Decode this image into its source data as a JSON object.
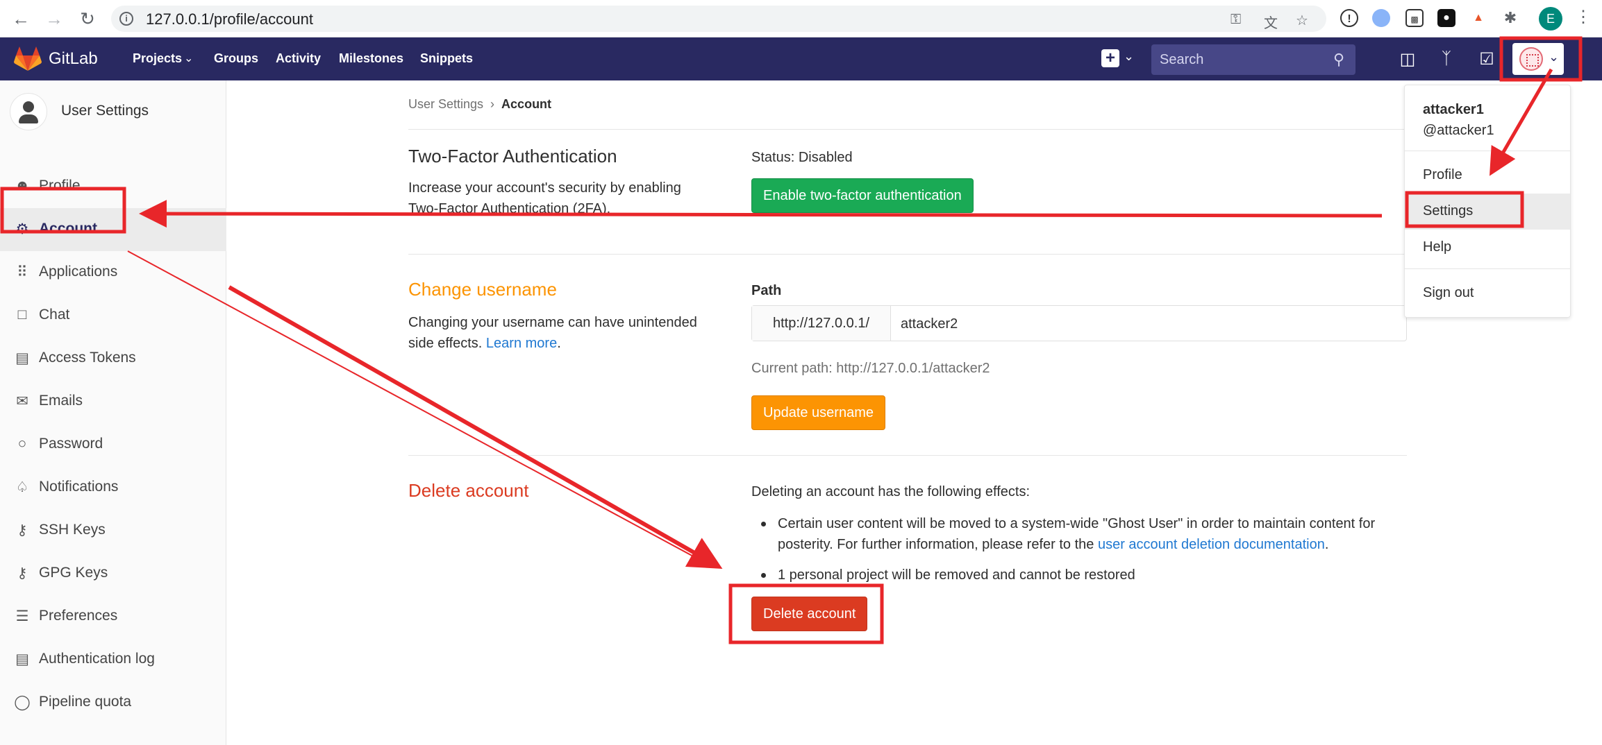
{
  "browser": {
    "url": "127.0.0.1/profile/account",
    "profile_initial": "E"
  },
  "header": {
    "brand": "GitLab",
    "nav": [
      {
        "label": "Projects"
      },
      {
        "label": "Groups"
      },
      {
        "label": "Activity"
      },
      {
        "label": "Milestones"
      },
      {
        "label": "Snippets"
      }
    ],
    "search_placeholder": "Search"
  },
  "sidebar": {
    "title": "User Settings",
    "items": [
      {
        "label": "Profile",
        "icon": "profile-icon"
      },
      {
        "label": "Account",
        "icon": "account-icon",
        "active": true
      },
      {
        "label": "Applications",
        "icon": "applications-icon"
      },
      {
        "label": "Chat",
        "icon": "chat-icon"
      },
      {
        "label": "Access Tokens",
        "icon": "token-icon"
      },
      {
        "label": "Emails",
        "icon": "email-icon"
      },
      {
        "label": "Password",
        "icon": "lock-icon"
      },
      {
        "label": "Notifications",
        "icon": "bell-icon"
      },
      {
        "label": "SSH Keys",
        "icon": "key-icon"
      },
      {
        "label": "GPG Keys",
        "icon": "key-icon"
      },
      {
        "label": "Preferences",
        "icon": "sliders-icon"
      },
      {
        "label": "Authentication log",
        "icon": "log-icon"
      },
      {
        "label": "Pipeline quota",
        "icon": "pipeline-icon"
      }
    ]
  },
  "breadcrumb": {
    "parent": "User Settings",
    "current": "Account"
  },
  "two_factor": {
    "title": "Two-Factor Authentication",
    "description": "Increase your account's security by enabling Two-Factor Authentication (2FA).",
    "status": "Status: Disabled",
    "button": "Enable two-factor authentication"
  },
  "change_username": {
    "title": "Change username",
    "description": "Changing your username can have unintended side effects.",
    "learn_more": "Learn more",
    "path_label": "Path",
    "path_prefix": "http://127.0.0.1/",
    "path_value": "attacker2",
    "current_path": "Current path: http://127.0.0.1/attacker2",
    "button": "Update username"
  },
  "delete_account": {
    "title": "Delete account",
    "intro": "Deleting an account has the following effects:",
    "bullet1_text": "Certain user content will be moved to a system-wide \"Ghost User\" in order to maintain content for posterity. For further information, please refer to the",
    "bullet1_link": "user account deletion documentation",
    "bullet2": "1 personal project will be removed and cannot be restored",
    "button": "Delete account"
  },
  "user_menu": {
    "name": "attacker1",
    "username": "@attacker1",
    "items": [
      {
        "label": "Profile"
      },
      {
        "label": "Settings"
      },
      {
        "label": "Help"
      },
      {
        "label": "Sign out"
      }
    ]
  },
  "colors": {
    "header_bg": "#292961",
    "annotation_red": "#e8262a",
    "green_button": "#1aaa55",
    "orange_button": "#fc9403",
    "red_button": "#db3b21",
    "orange_title": "#fc9403",
    "red_title": "#db3b21"
  }
}
